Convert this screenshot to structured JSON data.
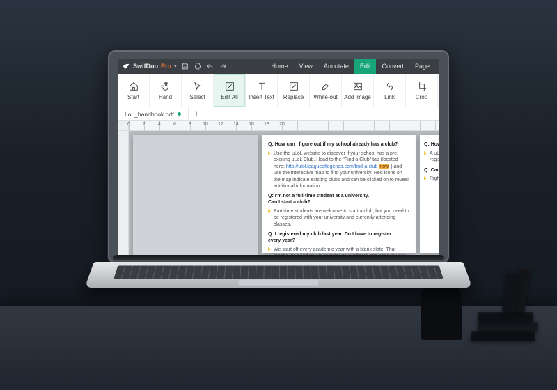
{
  "app": {
    "brand_main": "SwifDoo",
    "brand_suffix": "Pro"
  },
  "menu": {
    "items": [
      "Home",
      "View",
      "Annotate",
      "Edit",
      "Convert",
      "Page"
    ],
    "active": "Edit"
  },
  "ribbon": {
    "items": [
      {
        "key": "home-icon",
        "label": "Start"
      },
      {
        "key": "hand-icon",
        "label": "Hand"
      },
      {
        "key": "select-icon",
        "label": "Select"
      },
      {
        "key": "editall-icon",
        "label": "Edit All"
      },
      {
        "key": "inserttext-icon",
        "label": "Insert Text"
      },
      {
        "key": "replace-icon",
        "label": "Replace"
      },
      {
        "key": "whiteout-icon",
        "label": "White-out"
      },
      {
        "key": "addimage-icon",
        "label": "Add Image"
      },
      {
        "key": "link-icon",
        "label": "Link"
      },
      {
        "key": "crop-icon",
        "label": "Crop"
      }
    ],
    "active_index": 3
  },
  "filetab": {
    "name": "LoL_handbook.pdf",
    "modified": true
  },
  "ruler": {
    "ticks": [
      0,
      2,
      4,
      6,
      8,
      10,
      12,
      14,
      16,
      18,
      20
    ]
  },
  "doc": {
    "main": {
      "q1": "Q: How can I figure out if my school already has a club?",
      "a1_pre": "Use the uLoL website to discover if your school has a pre-existing uLoL Club. Head to the \"Find a Club\" tab (located here: ",
      "a1_link": "http://ulol.leagueoflegends.com/find-a-club",
      "a1_post": ") and use the interactive map to find your university. Red icons on the map indicate existing clubs and can be clicked on to reveal additional information.",
      "q2a": "Q: I'm not a full-time student at a university.",
      "q2b": "Can I start a club?",
      "a2": "Part-time students are welcome to start a club, but you need to be registered with your university and currently attending classes.",
      "q3a": "Q: I registered my club last year. Do I have to register",
      "q3b": "every year?",
      "a3": "We start off every academic year with a blank slate. That means we need you to register your officers and send in your charter even if it's the same as last year. It saves us"
    },
    "side": {
      "q1": "Q: How ma",
      "a1": "A uLoL club would registr",
      "q2": "Q: Can hig",
      "a2": "Right verifie"
    }
  }
}
